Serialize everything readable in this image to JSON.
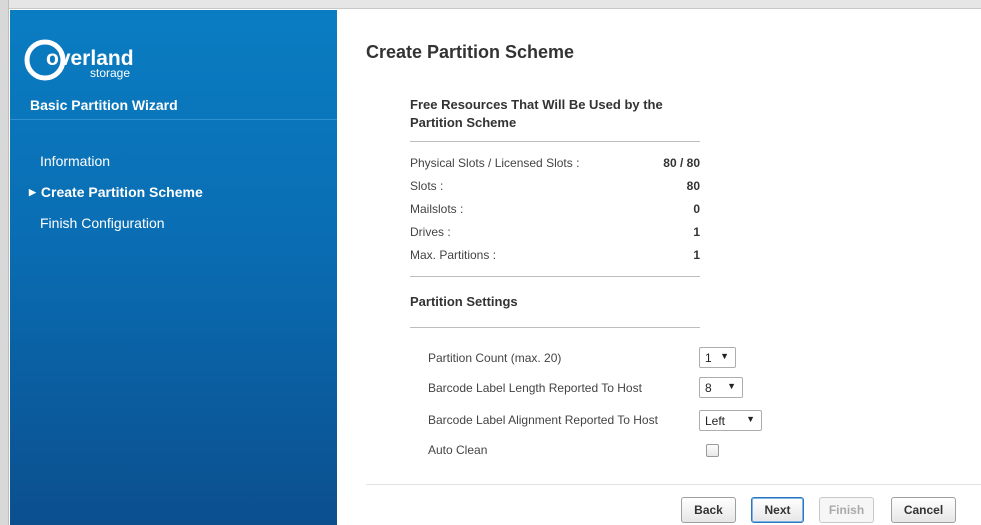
{
  "sidebar": {
    "logo_line1": "overland",
    "logo_line2": "storage",
    "wizard_title": "Basic Partition Wizard",
    "steps": [
      {
        "label": "Information"
      },
      {
        "label": "Create Partition Scheme",
        "active": true
      },
      {
        "label": "Finish Configuration"
      }
    ]
  },
  "main": {
    "title": "Create Partition Scheme",
    "resources_title": "Free Resources That Will Be Used by the Partition Scheme",
    "resources": [
      {
        "label": "Physical Slots / Licensed Slots :",
        "value": "80 / 80"
      },
      {
        "label": "Slots :",
        "value": "80"
      },
      {
        "label": "Mailslots :",
        "value": "0"
      },
      {
        "label": "Drives :",
        "value": "1"
      },
      {
        "label": "Max. Partitions :",
        "value": "1"
      }
    ],
    "settings_title": "Partition Settings",
    "settings": {
      "partition_count_label": "Partition Count (max. 20)",
      "partition_count_value": "1",
      "barcode_length_label": "Barcode Label Length Reported To Host",
      "barcode_length_value": "8",
      "barcode_alignment_label": "Barcode Label Alignment Reported To Host",
      "barcode_alignment_value": "Left",
      "auto_clean_label": "Auto Clean",
      "auto_clean_checked": false
    }
  },
  "buttons": {
    "back": "Back",
    "next": "Next",
    "finish": "Finish",
    "cancel": "Cancel"
  },
  "colors": {
    "sidebar_top": "#0a7dc2",
    "sidebar_bottom": "#0b4f8e",
    "primary_border": "#2b76c0"
  }
}
